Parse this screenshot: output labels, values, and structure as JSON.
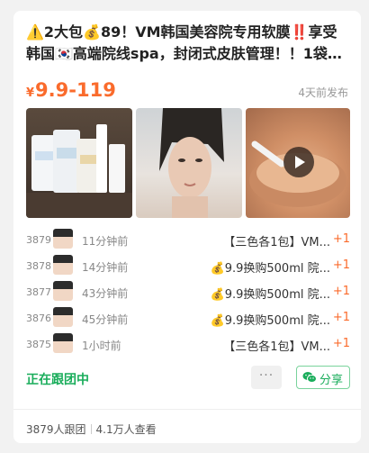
{
  "post": {
    "title": "⚠️2大包💰89！VM韩国美容院专用软膜‼️享受韩国🇰🇷高端院线spa，封闭式皮肤管理！！1袋一…",
    "price_symbol": "¥",
    "price_range": "9.9-119",
    "posted_ago": "4天前发布",
    "photos": [
      "product-photo",
      "face-mask-photo",
      "video-thumbnail"
    ],
    "video": true
  },
  "activity": [
    {
      "seq": "3879",
      "time": "11分钟前",
      "desc": "【三色各1包】VM...",
      "qty": "+1"
    },
    {
      "seq": "3878",
      "time": "14分钟前",
      "desc": "💰9.9换购500ml 院...",
      "qty": "+1"
    },
    {
      "seq": "3877",
      "time": "43分钟前",
      "desc": "💰9.9换购500ml 院...",
      "qty": "+1"
    },
    {
      "seq": "3876",
      "time": "45分钟前",
      "desc": "💰9.9换购500ml 院...",
      "qty": "+1"
    },
    {
      "seq": "3875",
      "time": "1小时前",
      "desc": "【三色各1包】VM...",
      "qty": "+1"
    }
  ],
  "footer": {
    "status": "正在跟团中",
    "more_label": "···",
    "share_label": "分享",
    "joined": "3879人跟团",
    "views": "4.1万人查看"
  },
  "colors": {
    "accent": "#fa6b2c",
    "green": "#1aad5b"
  }
}
